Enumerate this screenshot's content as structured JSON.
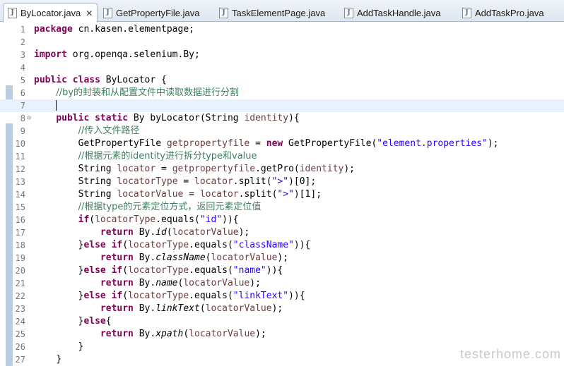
{
  "tabs": [
    {
      "label": "ByLocator.java",
      "active": true
    },
    {
      "label": "GetPropertyFile.java",
      "active": false
    },
    {
      "label": "TaskElementPage.java",
      "active": false
    },
    {
      "label": "AddTaskHandle.java",
      "active": false
    },
    {
      "label": "AddTaskPro.java",
      "active": false
    }
  ],
  "close_glyph": "✕",
  "java_icon_letter": "J",
  "fold_glyph": "⊖",
  "line_numbers": [
    "1",
    "2",
    "3",
    "4",
    "5",
    "6",
    "7",
    "8",
    "9",
    "10",
    "11",
    "12",
    "13",
    "14",
    "15",
    "16",
    "17",
    "18",
    "19",
    "20",
    "21",
    "22",
    "23",
    "24",
    "25",
    "26",
    "27"
  ],
  "code": {
    "l1": {
      "kw": "package",
      "rest": " cn.kasen.elementpage;"
    },
    "l3": {
      "kw": "import",
      "rest": " org.openqa.selenium.By;"
    },
    "l5": {
      "kw1": "public",
      "kw2": "class",
      "rest": " ByLocator {"
    },
    "l6": {
      "comment": "//by的封装和从配置文件中读取数据进行分割"
    },
    "l8": {
      "kw1": "public",
      "kw2": "static",
      "pre": " By byLocator(String ",
      "param": "identity",
      "post": "){"
    },
    "l9": {
      "comment": "//传入文件路径"
    },
    "l10": {
      "pre": "GetPropertyFile ",
      "var": "getpropertyfile",
      "mid": " = ",
      "kw": "new",
      "post": " GetPropertyFile(",
      "str": "\"element.properties\"",
      "end": ");"
    },
    "l11": {
      "comment": "//根据元素的identity进行拆分type和value"
    },
    "l12": {
      "pre": "String ",
      "var": "locator",
      "mid": " = ",
      "var2": "getpropertyfile",
      "post": ".getPro(",
      "arg": "identity",
      "end": ");"
    },
    "l13": {
      "pre": "String ",
      "var": "locatorType",
      "mid": " = ",
      "var2": "locator",
      "post": ".split(",
      "str": "\">\"",
      "end": ")[0];"
    },
    "l14": {
      "pre": "String ",
      "var": "locatorValue",
      "mid": " = ",
      "var2": "locator",
      "post": ".split(",
      "str": "\">\"",
      "end": ")[1];"
    },
    "l15": {
      "comment": "//根据type的元素定位方式，返回元素定位值"
    },
    "l16": {
      "kw": "if",
      "pre": "(",
      "var": "locatorType",
      "post": ".equals(",
      "str": "\"id\"",
      "end": ")){"
    },
    "l17": {
      "kw": "return",
      "pre": " By.",
      "method": "id",
      "post": "(",
      "var": "locatorValue",
      "end": ");"
    },
    "l18": {
      "pre": "}",
      "kw": "else if",
      "pre2": "(",
      "var": "locatorType",
      "post": ".equals(",
      "str": "\"className\"",
      "end": ")){"
    },
    "l19": {
      "kw": "return",
      "pre": " By.",
      "method": "className",
      "post": "(",
      "var": "locatorValue",
      "end": ");"
    },
    "l20": {
      "pre": "}",
      "kw": "else if",
      "pre2": "(",
      "var": "locatorType",
      "post": ".equals(",
      "str": "\"name\"",
      "end": ")){"
    },
    "l21": {
      "kw": "return",
      "pre": " By.",
      "method": "name",
      "post": "(",
      "var": "locatorValue",
      "end": ");"
    },
    "l22": {
      "pre": "}",
      "kw": "else if",
      "pre2": "(",
      "var": "locatorType",
      "post": ".equals(",
      "str": "\"linkText\"",
      "end": ")){"
    },
    "l23": {
      "kw": "return",
      "pre": " By.",
      "method": "linkText",
      "post": "(",
      "var": "locatorValue",
      "end": ");"
    },
    "l24": {
      "pre": "}",
      "kw": "else",
      "end": "{"
    },
    "l25": {
      "kw": "return",
      "pre": " By.",
      "method": "xpath",
      "post": "(",
      "var": "locatorValue",
      "end": ");"
    },
    "l26": {
      "text": "}"
    },
    "l27": {
      "text": "}"
    }
  },
  "watermark": "testerhome.com"
}
